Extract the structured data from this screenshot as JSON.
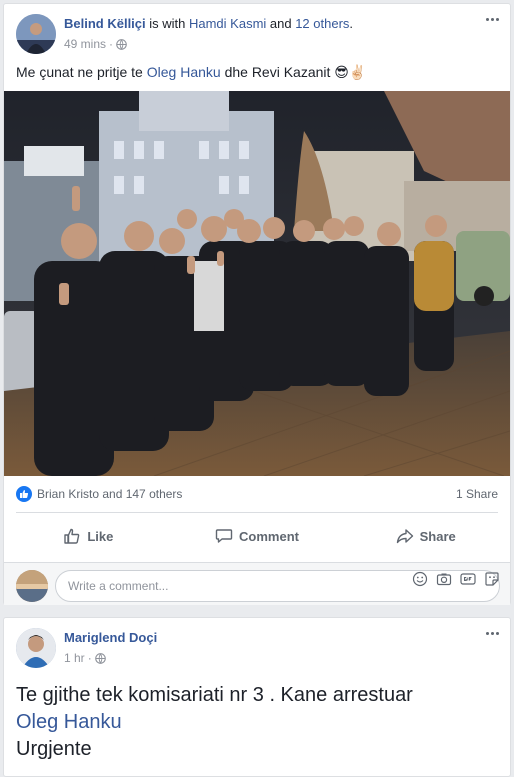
{
  "post1": {
    "author": "Belind Këlliçi",
    "with_prefix": " is with ",
    "tagged": "Hamdi Kasmi",
    "and_text": " and ",
    "others_link": "12 others",
    "period": ".",
    "time": "49 mins",
    "text_before": "Me çunat ne pritje te ",
    "mention": "Oleg Hanku",
    "text_after": " dhe Revi Kazanit 😎✌🏻",
    "reactions": "Brian Kristo and 147 others",
    "shares": "1 Share",
    "like_label": "Like",
    "comment_label": "Comment",
    "share_label": "Share",
    "comment_placeholder": "Write a comment...",
    "icon_more": "more-icon",
    "icon_globe": "globe-icon"
  },
  "post2": {
    "author": "Mariglend Doçi",
    "time": "1 hr",
    "line1": "Te gjithe tek komisariati nr 3 . Kane arrestuar",
    "mention": "Oleg Hanku",
    "line3": "Urgjente"
  },
  "colors": {
    "link": "#365899",
    "like_blue": "#1877f2",
    "background": "#e9ebee"
  }
}
